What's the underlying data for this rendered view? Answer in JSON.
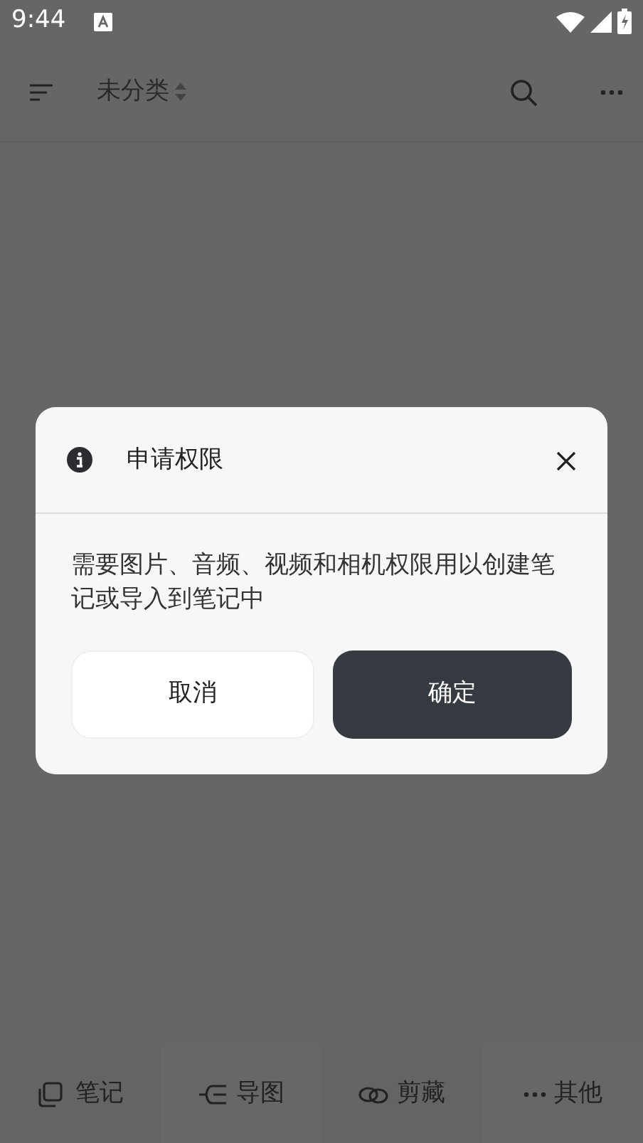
{
  "status_bar": {
    "time": "9:44"
  },
  "toolbar": {
    "category": "未分类"
  },
  "dialog": {
    "title": "申请权限",
    "message": "需要图片、音频、视频和相机权限用以创建笔记或导入到笔记中",
    "buttons": [
      {
        "label": "取消",
        "kind": "secondary"
      },
      {
        "label": "确定",
        "kind": "primary"
      }
    ]
  },
  "bottom_tabs": [
    {
      "label": "笔记",
      "kind": "notes",
      "selected": false
    },
    {
      "label": "导图",
      "kind": "mindmap",
      "selected": false
    },
    {
      "label": "剪藏",
      "kind": "clip",
      "selected": false
    },
    {
      "label": "其他",
      "kind": "more",
      "selected": false
    }
  ]
}
